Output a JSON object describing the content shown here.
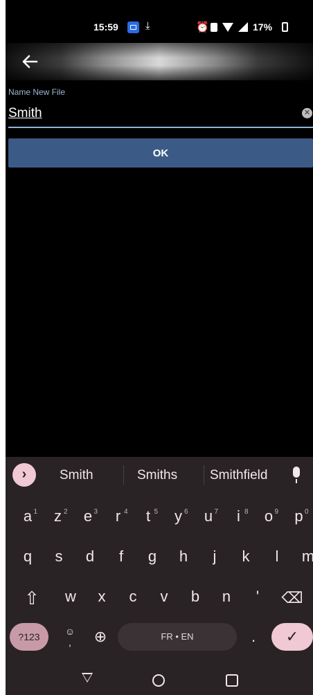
{
  "status_bar": {
    "time": "15:59",
    "download_icon": "⤓",
    "alarm_icon": "⏰",
    "battery": "17%"
  },
  "toolbar": {
    "back_icon": "arrow-left"
  },
  "form": {
    "label": "Name New File",
    "value": "Smith",
    "clear_icon": "✕",
    "ok_label": "OK"
  },
  "keyboard": {
    "expand_icon": "›",
    "suggestions": [
      "Smith",
      "Smiths",
      "Smithfield"
    ],
    "row1": [
      {
        "k": "a",
        "n": "1"
      },
      {
        "k": "z",
        "n": "2"
      },
      {
        "k": "e",
        "n": "3"
      },
      {
        "k": "r",
        "n": "4"
      },
      {
        "k": "t",
        "n": "5"
      },
      {
        "k": "y",
        "n": "6"
      },
      {
        "k": "u",
        "n": "7"
      },
      {
        "k": "i",
        "n": "8"
      },
      {
        "k": "o",
        "n": "9"
      },
      {
        "k": "p",
        "n": "0"
      }
    ],
    "row2": [
      "q",
      "s",
      "d",
      "f",
      "g",
      "h",
      "j",
      "k",
      "l",
      "m"
    ],
    "row3": [
      "w",
      "x",
      "c",
      "v",
      "b",
      "n",
      "'"
    ],
    "shift_icon": "⇧",
    "backspace_icon": "⌫",
    "symbols_label": "?123",
    "emoji_top": "☺",
    "emoji_bottom": ",",
    "globe_icon": "⊕",
    "space_label": "FR • EN",
    "period_label": ".",
    "enter_icon": "✓"
  },
  "colors": {
    "accent": "#3c5a86",
    "keyboard_bg": "#2a2326",
    "pink": "#f0c9d4"
  }
}
